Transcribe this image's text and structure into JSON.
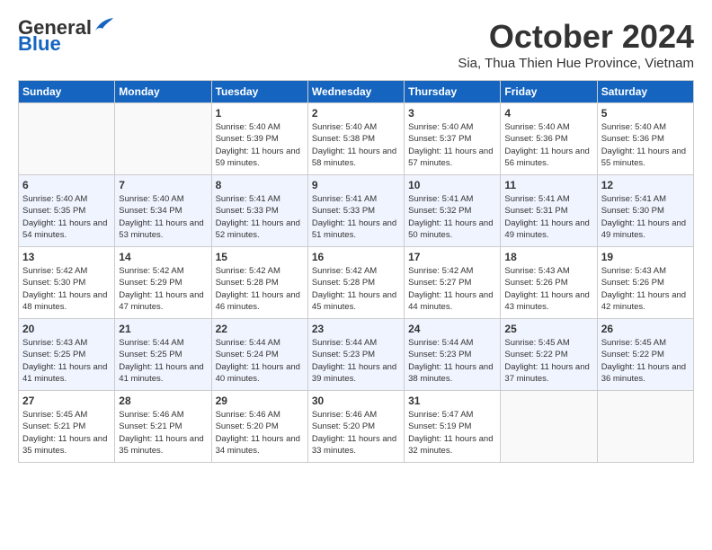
{
  "header": {
    "logo_general": "General",
    "logo_blue": "Blue",
    "month": "October 2024",
    "location": "Sia, Thua Thien Hue Province, Vietnam"
  },
  "weekdays": [
    "Sunday",
    "Monday",
    "Tuesday",
    "Wednesday",
    "Thursday",
    "Friday",
    "Saturday"
  ],
  "weeks": [
    [
      {
        "day": null
      },
      {
        "day": null
      },
      {
        "day": "1",
        "sunrise": "5:40 AM",
        "sunset": "5:39 PM",
        "daylight": "11 hours and 59 minutes."
      },
      {
        "day": "2",
        "sunrise": "5:40 AM",
        "sunset": "5:38 PM",
        "daylight": "11 hours and 58 minutes."
      },
      {
        "day": "3",
        "sunrise": "5:40 AM",
        "sunset": "5:37 PM",
        "daylight": "11 hours and 57 minutes."
      },
      {
        "day": "4",
        "sunrise": "5:40 AM",
        "sunset": "5:36 PM",
        "daylight": "11 hours and 56 minutes."
      },
      {
        "day": "5",
        "sunrise": "5:40 AM",
        "sunset": "5:36 PM",
        "daylight": "11 hours and 55 minutes."
      }
    ],
    [
      {
        "day": "6",
        "sunrise": "5:40 AM",
        "sunset": "5:35 PM",
        "daylight": "11 hours and 54 minutes."
      },
      {
        "day": "7",
        "sunrise": "5:40 AM",
        "sunset": "5:34 PM",
        "daylight": "11 hours and 53 minutes."
      },
      {
        "day": "8",
        "sunrise": "5:41 AM",
        "sunset": "5:33 PM",
        "daylight": "11 hours and 52 minutes."
      },
      {
        "day": "9",
        "sunrise": "5:41 AM",
        "sunset": "5:33 PM",
        "daylight": "11 hours and 51 minutes."
      },
      {
        "day": "10",
        "sunrise": "5:41 AM",
        "sunset": "5:32 PM",
        "daylight": "11 hours and 50 minutes."
      },
      {
        "day": "11",
        "sunrise": "5:41 AM",
        "sunset": "5:31 PM",
        "daylight": "11 hours and 49 minutes."
      },
      {
        "day": "12",
        "sunrise": "5:41 AM",
        "sunset": "5:30 PM",
        "daylight": "11 hours and 49 minutes."
      }
    ],
    [
      {
        "day": "13",
        "sunrise": "5:42 AM",
        "sunset": "5:30 PM",
        "daylight": "11 hours and 48 minutes."
      },
      {
        "day": "14",
        "sunrise": "5:42 AM",
        "sunset": "5:29 PM",
        "daylight": "11 hours and 47 minutes."
      },
      {
        "day": "15",
        "sunrise": "5:42 AM",
        "sunset": "5:28 PM",
        "daylight": "11 hours and 46 minutes."
      },
      {
        "day": "16",
        "sunrise": "5:42 AM",
        "sunset": "5:28 PM",
        "daylight": "11 hours and 45 minutes."
      },
      {
        "day": "17",
        "sunrise": "5:42 AM",
        "sunset": "5:27 PM",
        "daylight": "11 hours and 44 minutes."
      },
      {
        "day": "18",
        "sunrise": "5:43 AM",
        "sunset": "5:26 PM",
        "daylight": "11 hours and 43 minutes."
      },
      {
        "day": "19",
        "sunrise": "5:43 AM",
        "sunset": "5:26 PM",
        "daylight": "11 hours and 42 minutes."
      }
    ],
    [
      {
        "day": "20",
        "sunrise": "5:43 AM",
        "sunset": "5:25 PM",
        "daylight": "11 hours and 41 minutes."
      },
      {
        "day": "21",
        "sunrise": "5:44 AM",
        "sunset": "5:25 PM",
        "daylight": "11 hours and 41 minutes."
      },
      {
        "day": "22",
        "sunrise": "5:44 AM",
        "sunset": "5:24 PM",
        "daylight": "11 hours and 40 minutes."
      },
      {
        "day": "23",
        "sunrise": "5:44 AM",
        "sunset": "5:23 PM",
        "daylight": "11 hours and 39 minutes."
      },
      {
        "day": "24",
        "sunrise": "5:44 AM",
        "sunset": "5:23 PM",
        "daylight": "11 hours and 38 minutes."
      },
      {
        "day": "25",
        "sunrise": "5:45 AM",
        "sunset": "5:22 PM",
        "daylight": "11 hours and 37 minutes."
      },
      {
        "day": "26",
        "sunrise": "5:45 AM",
        "sunset": "5:22 PM",
        "daylight": "11 hours and 36 minutes."
      }
    ],
    [
      {
        "day": "27",
        "sunrise": "5:45 AM",
        "sunset": "5:21 PM",
        "daylight": "11 hours and 35 minutes."
      },
      {
        "day": "28",
        "sunrise": "5:46 AM",
        "sunset": "5:21 PM",
        "daylight": "11 hours and 35 minutes."
      },
      {
        "day": "29",
        "sunrise": "5:46 AM",
        "sunset": "5:20 PM",
        "daylight": "11 hours and 34 minutes."
      },
      {
        "day": "30",
        "sunrise": "5:46 AM",
        "sunset": "5:20 PM",
        "daylight": "11 hours and 33 minutes."
      },
      {
        "day": "31",
        "sunrise": "5:47 AM",
        "sunset": "5:19 PM",
        "daylight": "11 hours and 32 minutes."
      },
      {
        "day": null
      },
      {
        "day": null
      }
    ]
  ],
  "labels": {
    "sunrise": "Sunrise:",
    "sunset": "Sunset:",
    "daylight": "Daylight: "
  }
}
